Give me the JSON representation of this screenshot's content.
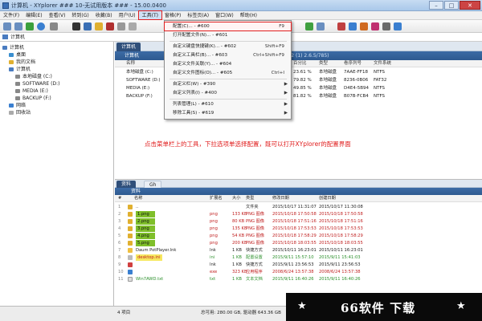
{
  "window": {
    "title": "计算机 - XYplorer ### 10-无试用版本 ### - 15.00.0400"
  },
  "menubar": {
    "items": [
      "文件(F)",
      "编辑(E)",
      "查看(V)",
      "转到(G)",
      "收藏(B)",
      "用户(U)",
      "工具(T)",
      "窗格(P)",
      "标签页(A)",
      "窗口(W)",
      "帮助(H)"
    ]
  },
  "address": {
    "text": "计算机"
  },
  "tree": {
    "items": [
      "计算机",
      "桌面",
      "我的文档",
      "计算机",
      "本地磁盘 (C:)",
      "SOFTWARE (D:)",
      "MEDIA (E:)",
      "BACKUP (F:)",
      "网络",
      "回收站"
    ]
  },
  "top_pane": {
    "tab_label": "计算机",
    "tab2_label": "",
    "breadcrumb": "计算机",
    "breadcrumb_right": "Mf2 (1) 2.6.5/785)",
    "columns": [
      "名称",
      "",
      "",
      "",
      "",
      "百分比",
      "类型",
      "卷序列号",
      "文件系统"
    ],
    "drives": [
      {
        "name": "本地磁盘 (C:)",
        "pct": "23.61 %",
        "type": "本地磁盘",
        "serial": "7AAE-FF18",
        "fs": "NTFS"
      },
      {
        "name": "SOFTWARE (D:)",
        "pct": "79.82 %",
        "type": "本地磁盘",
        "serial": "8236-0B06",
        "fs": "FAT32"
      },
      {
        "name": "MEDIA (E:)",
        "pct": "49.85 %",
        "type": "本地磁盘",
        "serial": "D4E4-5B94",
        "fs": "NTFS"
      },
      {
        "name": "BACKUP (F:)",
        "pct": "81.82 %",
        "type": "本地磁盘",
        "serial": "B07B-FCB4",
        "fs": "NTFS"
      }
    ]
  },
  "annotation": {
    "text": "点击菜单栏上的工具，下拉选项单选择配置，既可以打开XYplorer的配置界面"
  },
  "dropdown": {
    "items": [
      {
        "label": "配置(C)... - #600",
        "shortcut": "F9",
        "arrow": "",
        "highlight": true
      },
      {
        "label": "打开配置文件(N)... - #601",
        "shortcut": "",
        "arrow": ""
      },
      {
        "label": "自定义键盘快捷键(K)... - #602",
        "shortcut": "Shift+F9",
        "arrow": ""
      },
      {
        "label": "自定义工具栏(B)... - #603",
        "shortcut": "Ctrl+Shift+F9",
        "arrow": ""
      },
      {
        "label": "自定义文件关联(Y)... - #604",
        "shortcut": "",
        "arrow": ""
      },
      {
        "label": "自定义文件图标(O)... - #605",
        "shortcut": "Ctrl+I",
        "arrow": ""
      },
      {
        "label": "自定义栏(W) - #390",
        "shortcut": "",
        "arrow": "▶"
      },
      {
        "label": "自定义列表(I) - #400",
        "shortcut": "",
        "arrow": "▶"
      },
      {
        "label": "列表管理(L) - #610",
        "shortcut": "",
        "arrow": "▶"
      },
      {
        "label": "移除工具(S) - #619",
        "shortcut": "",
        "arrow": "▶"
      }
    ]
  },
  "bottom_pane": {
    "tab_label": "资料",
    "tab2_label": "Gh",
    "crumb": "资料",
    "columns": [
      "#",
      "名称",
      "扩展名",
      "大小",
      "类型",
      "修改日期",
      "创建日期"
    ],
    "rows": [
      {
        "num": "1",
        "name": "..",
        "ext": "",
        "size": "",
        "type": "文件夹",
        "mod": "2015/10/17 11:31:07",
        "created": "2015/10/17 11:30:08"
      },
      {
        "num": "2",
        "name": "1.png",
        "ext": "png",
        "size": "133 KB",
        "type": "PNG 图像",
        "mod": "2015/10/18 17:50:58",
        "created": "2015/10/18 17:50:58"
      },
      {
        "num": "3",
        "name": "2.png",
        "ext": "png",
        "size": "80 KB",
        "type": "PNG 图像",
        "mod": "2015/10/18 17:51:16",
        "created": "2015/10/18 17:51:16"
      },
      {
        "num": "4",
        "name": "3.png",
        "ext": "png",
        "size": "135 KB",
        "type": "PNG 图像",
        "mod": "2015/10/18 17:53:53",
        "created": "2015/10/18 17:53:53"
      },
      {
        "num": "5",
        "name": "4.png",
        "ext": "png",
        "size": "54 KB",
        "type": "PNG 图像",
        "mod": "2015/10/18 17:58:29",
        "created": "2015/10/18 17:58:29"
      },
      {
        "num": "6",
        "name": "5.png",
        "ext": "png",
        "size": "200 KB",
        "type": "PNG 图像",
        "mod": "2015/10/18 18:03:55",
        "created": "2015/10/18 18:03:55"
      },
      {
        "num": "7",
        "name": "Daum PotPlayer.lnk",
        "ext": "lnk",
        "size": "1 KB",
        "type": "快捷方式",
        "mod": "2015/10/11 16:23:01",
        "created": "2015/10/11 16:23:01"
      },
      {
        "num": "8",
        "name": "desktop.ini",
        "ext": "ini",
        "size": "1 KB",
        "type": "配置设置",
        "mod": "2015/9/11 15:57:10",
        "created": "2015/9/11 15:41:03"
      },
      {
        "num": "9",
        "name": "",
        "ext": "lnk",
        "size": "1 KB",
        "type": "快捷方式",
        "mod": "2015/9/11 23:56:53",
        "created": "2015/9/11 23:56:53"
      },
      {
        "num": "10",
        "name": "",
        "ext": "exe",
        "size": "323 KB",
        "type": "应用程序",
        "mod": "2008/6/24 13:57:38",
        "created": "2008/6/24 13:57:38"
      },
      {
        "num": "11",
        "name": "Win7AWD.txt",
        "ext": "txt",
        "size": "1 KB",
        "type": "文本文档",
        "mod": "2015/9/11 16:40:26",
        "created": "2015/9/11 16:40:26"
      }
    ]
  },
  "status": {
    "left": "4 项目",
    "right": "总可用: 280.00 GB, 驱动器 643.36 GB"
  },
  "watermark": {
    "text": "66软件 下载",
    "star": "★"
  },
  "colors": {
    "accent": "#2e5a90",
    "highlight_red": "#e02020",
    "annotation": "#e01b1b",
    "file_highlight": "#7fbf2a"
  }
}
